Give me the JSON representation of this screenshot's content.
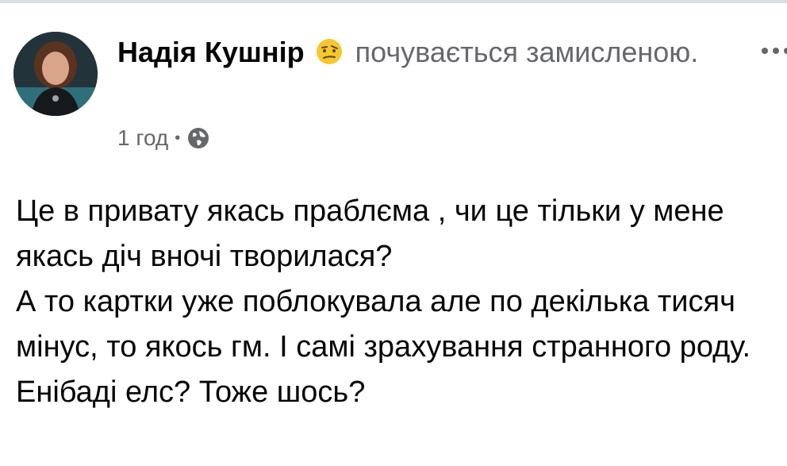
{
  "post": {
    "author": "Надія Кушнір",
    "feeling_text": "почувається замисленою.",
    "feeling_icon": "thinking-face-icon",
    "timestamp": "1 год",
    "separator": "•",
    "audience_icon": "globe-icon",
    "body_lines": [
      "Це в привату якась праблєма , чи це тільки у мене якась діч вночі творилася?",
      "А то картки уже поблокувала але по декілька тисяч мінус, то якось гм. І самі зрахування странного роду.",
      "Енібаді елс? Тоже шось?"
    ]
  },
  "colors": {
    "text_primary": "#050505",
    "text_secondary": "#65676b",
    "divider": "#dadde1",
    "emoji_face": "#f7c72f"
  }
}
